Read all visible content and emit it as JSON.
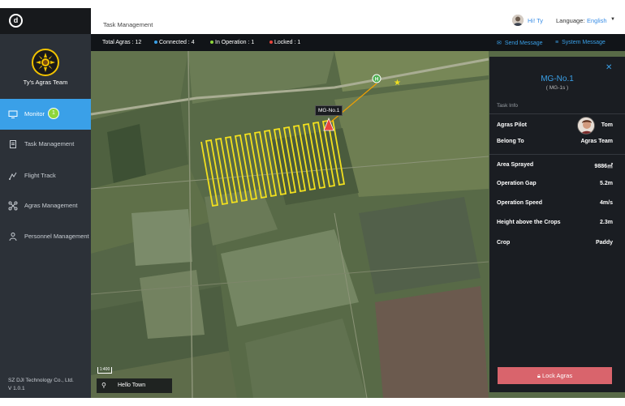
{
  "sidebar": {
    "team_name": "Ty's Agras Team",
    "items": [
      {
        "label": "Monitor",
        "icon": "monitor-icon",
        "active": true,
        "badge": "1"
      },
      {
        "label": "Task Management",
        "icon": "clipboard-icon"
      },
      {
        "label": "Flight Track",
        "icon": "route-icon"
      },
      {
        "label": "Agras Management",
        "icon": "drone-icon"
      },
      {
        "label": "Personnel Management",
        "icon": "people-icon"
      }
    ],
    "copyright_line1": "SZ DJI Technology Co., Ltd.",
    "copyright_line2": "V 1.0.1"
  },
  "header": {
    "title": "Task Management",
    "greeting": "Hi! Ty",
    "language_label": "Language:",
    "language_value": "English"
  },
  "stats": {
    "total": "Total Agras : 12",
    "connected": "Connected : 4",
    "in_operation": "In Operation : 1",
    "locked": "Locked : 1",
    "send_message": "Send Message",
    "system_message": "System Message"
  },
  "map": {
    "scale_label": "1:400",
    "location": "Hello Town",
    "drone_callout": "MG-No.1",
    "home_marker": "H"
  },
  "panel": {
    "title": "MG-No.1",
    "subtitle": "( MG-1s )",
    "section": "Task Info",
    "pilot_label": "Agras Pilot",
    "pilot_value": "Tom",
    "belong_label": "Belong To",
    "belong_value": "Agras Team",
    "area_label": "Area Sprayed",
    "area_value": "9886㎡",
    "gap_label": "Operation Gap",
    "gap_value": "5.2m",
    "speed_label": "Operation Speed",
    "speed_value": "4m/s",
    "height_label": "Height above the Crops",
    "height_value": "2.3m",
    "crop_label": "Crop",
    "crop_value": "Paddy",
    "lock_button": "Lock Agras"
  },
  "colors": {
    "accent": "#3aa0e8",
    "sidebar_bg": "#2c3138",
    "active_nav": "#3aa0e8",
    "connected_dot": "#3aa0e8",
    "operation_dot": "#8ed63a",
    "locked_dot": "#e8453c",
    "flight_path": "#f2e01e",
    "lock_button": "#d9646c"
  }
}
